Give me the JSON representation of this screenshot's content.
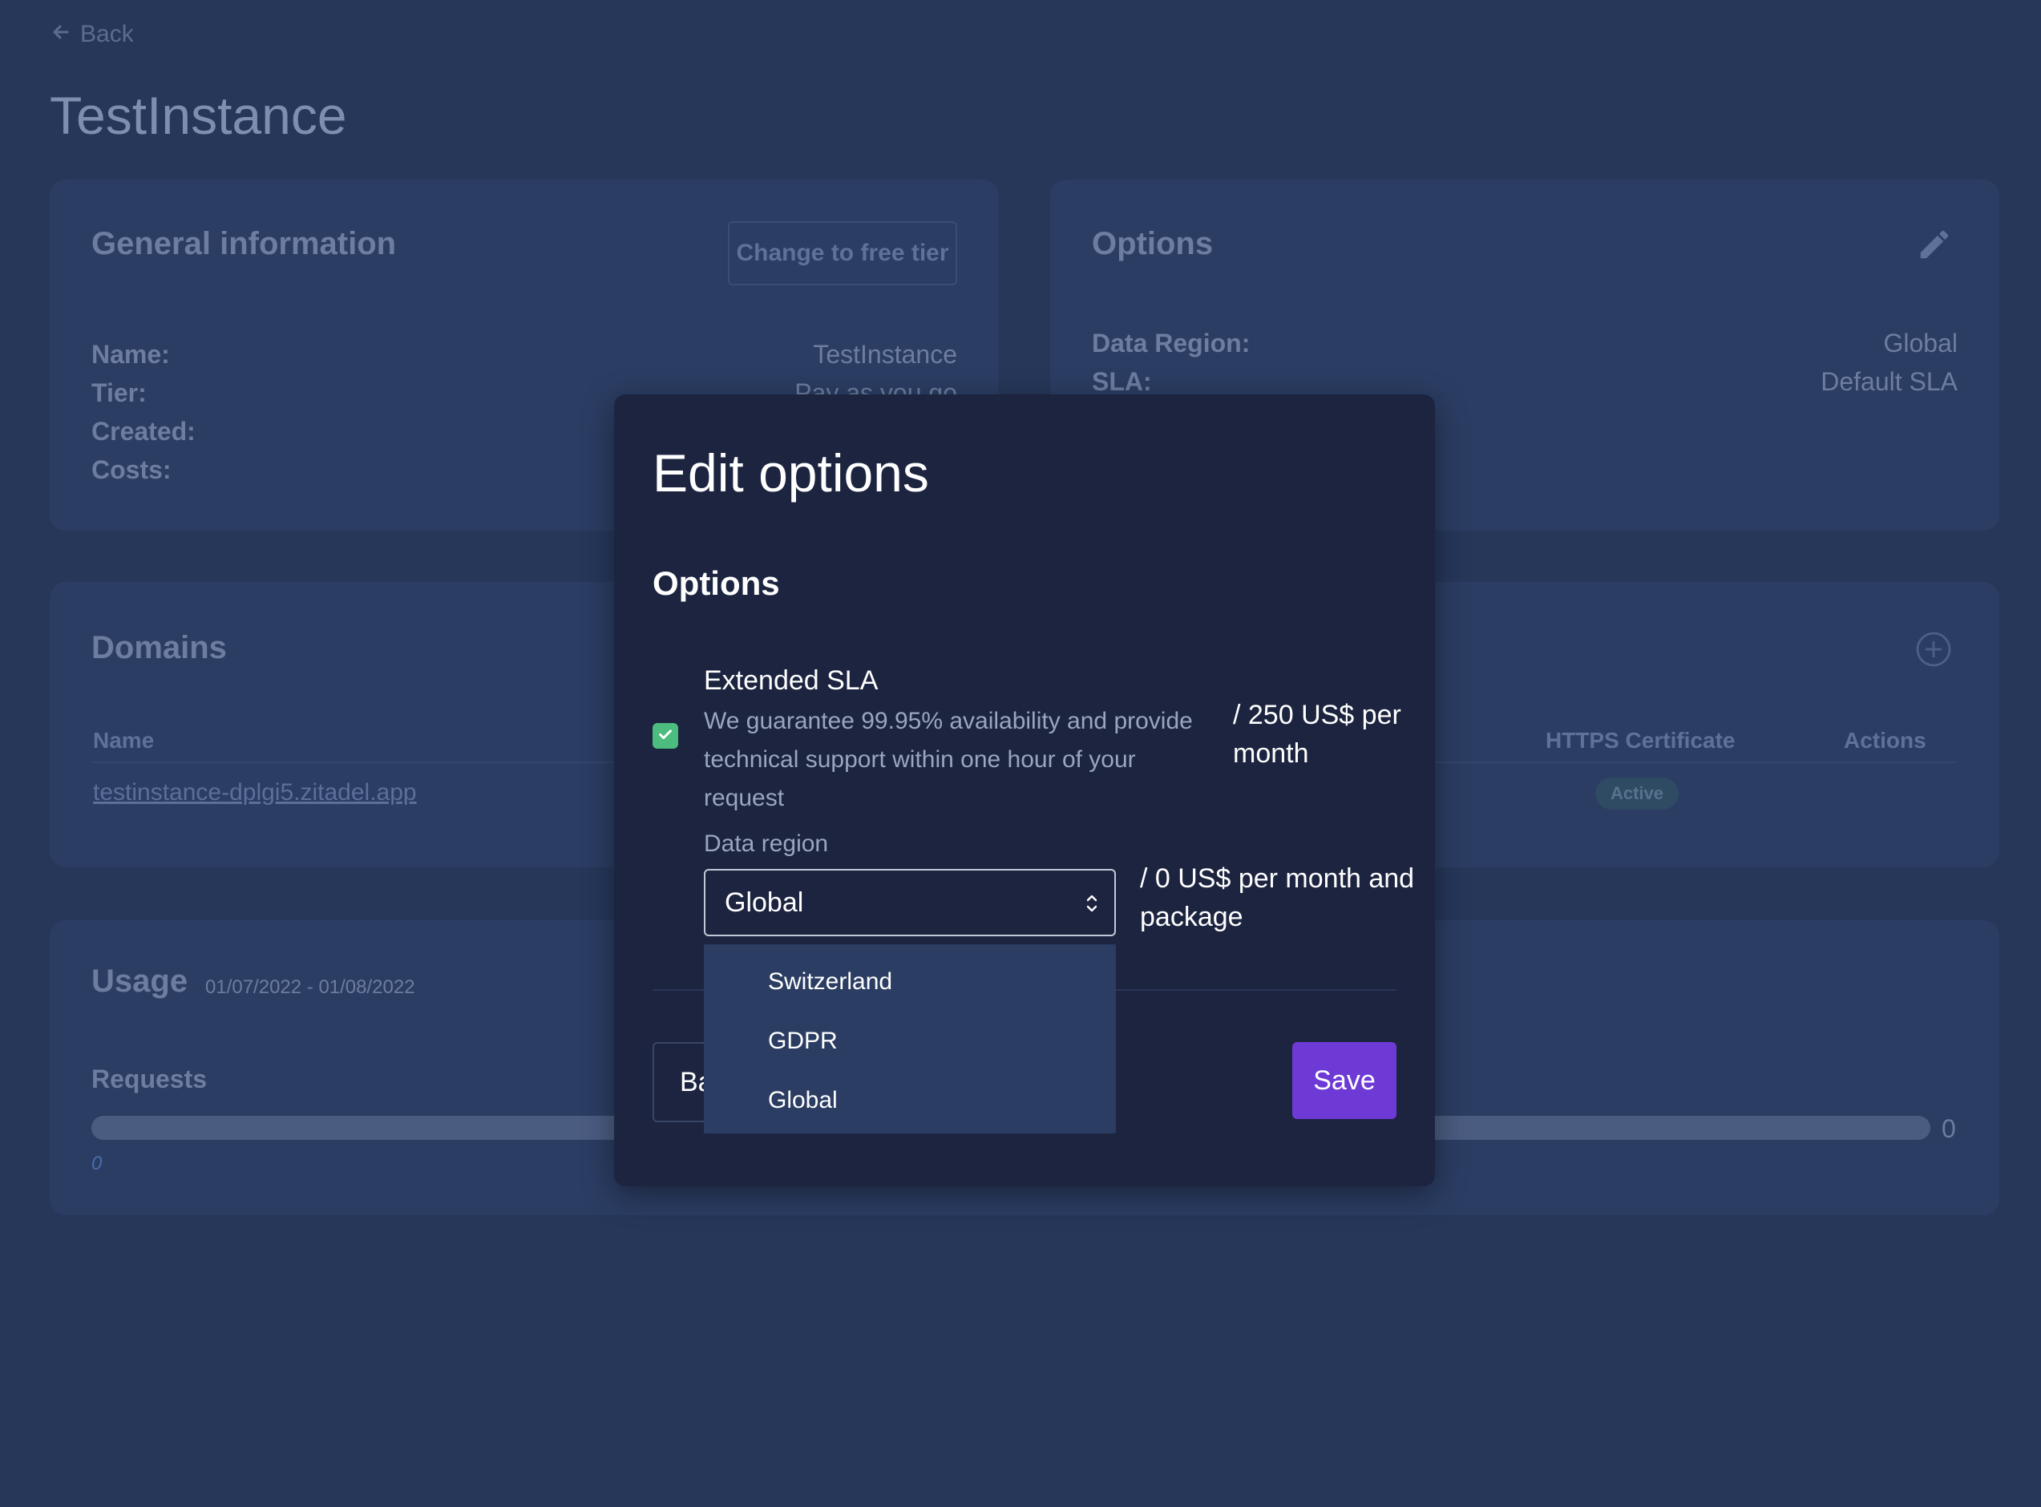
{
  "page": {
    "back_label": "Back",
    "title": "TestInstance"
  },
  "general": {
    "title": "General information",
    "change_tier_label": "Change to free tier",
    "rows": [
      {
        "label": "Name:",
        "value": "TestInstance"
      },
      {
        "label": "Tier:",
        "value": "Pay as you go"
      },
      {
        "label": "Created:",
        "value": ""
      },
      {
        "label": "Costs:",
        "value": ""
      }
    ]
  },
  "options_card": {
    "title": "Options",
    "rows": [
      {
        "label": "Data Region:",
        "value": "Global"
      },
      {
        "label": "SLA:",
        "value": "Default SLA"
      }
    ]
  },
  "domains": {
    "title": "Domains",
    "columns": [
      "Name",
      "HTTPS Certificate",
      "Actions"
    ],
    "rows": [
      {
        "name": "testinstance-dplgi5.zitadel.app",
        "https": "Active"
      }
    ]
  },
  "usage": {
    "title": "Usage",
    "range": "01/07/2022 - 01/08/2022",
    "requests_label": "Requests",
    "requests_min": "0",
    "requests_max": "0"
  },
  "modal": {
    "title": "Edit options",
    "section_title": "Options",
    "sla": {
      "title": "Extended SLA",
      "description": "We guarantee 99.95% availability and provide technical support within one hour of your request",
      "price": "/ 250 US$ per month",
      "checked": true
    },
    "region": {
      "label": "Data region",
      "selected": "Global",
      "price": "/ 0 US$ per month and package",
      "options": [
        "Switzerland",
        "GDPR",
        "Global"
      ]
    },
    "back_label": "Back",
    "save_label": "Save"
  },
  "colors": {
    "accent": "#6e3ad6",
    "checkbox": "#4cbd7e",
    "background": "#1c2847",
    "modal": "#1c2440"
  }
}
